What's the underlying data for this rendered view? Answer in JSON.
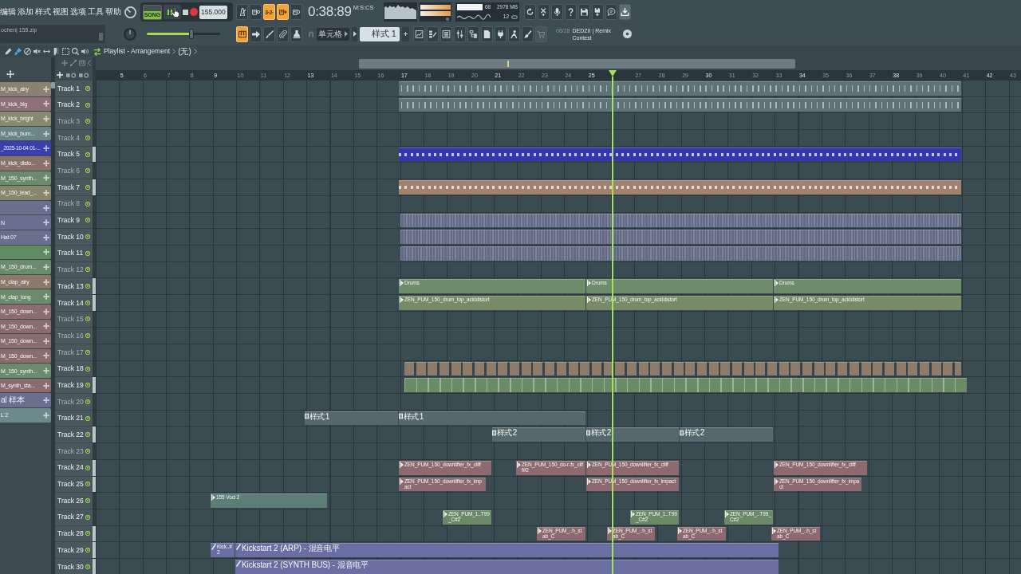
{
  "menu": [
    "编辑",
    "添加",
    "样式",
    "视图",
    "选项",
    "工具",
    "帮助"
  ],
  "hint_bar": "ochen| 155.zip",
  "transport": {
    "mode": "SONG",
    "song_mode": true,
    "playing": true,
    "tempo": "155.000"
  },
  "toggles": [
    {
      "kind": "metronome",
      "on": false
    },
    {
      "kind": "wait",
      "on": false
    },
    {
      "kind": "countdown",
      "label": "3·2·",
      "on": true
    },
    {
      "kind": "blend",
      "on": true
    },
    {
      "kind": "loop",
      "on": false
    }
  ],
  "time": {
    "value": "0:38:89",
    "format": "M:S:CS"
  },
  "monitor": {
    "cpu": "68",
    "memory": "2978 MB",
    "voices": "12"
  },
  "master_volume": {
    "level": 0.61
  },
  "tools": [
    {
      "kind": "typing",
      "on": true
    },
    {
      "kind": "step",
      "on": false
    },
    {
      "kind": "script",
      "on": false
    },
    {
      "kind": "link",
      "on": false
    },
    {
      "kind": "stamp",
      "on": false
    }
  ],
  "snap": "单元格",
  "pattern": "样式 1",
  "news": {
    "date": "08/28",
    "headline": "DEDZII | Remix Contest"
  },
  "playlist_bar": {
    "tools": [
      {
        "kind": "draw",
        "selected": false
      },
      {
        "kind": "paint",
        "selected": true
      },
      {
        "kind": "delete",
        "selected": false
      },
      {
        "kind": "mute",
        "selected": false
      },
      {
        "kind": "slip",
        "selected": false
      },
      {
        "kind": "slice",
        "selected": false
      },
      {
        "kind": "select",
        "selected": false
      },
      {
        "kind": "zoom",
        "selected": false
      },
      {
        "kind": "playback",
        "selected": false
      }
    ],
    "title": "Playlist - Arrangement",
    "arrangement": "(无)"
  },
  "clip_sources": [
    {
      "label": "M_kick_airy",
      "color": "#8b8170"
    },
    {
      "label": "M_kick_big",
      "color": "#8e6f7a"
    },
    {
      "label": "M_kick_bright",
      "color": "#878a6c"
    },
    {
      "label": "M_kick_bum...",
      "color": "#6b8784"
    },
    {
      "label": "_2025-10-04 01-...",
      "color": "#3b3fae"
    },
    {
      "label": "M_kick_disto...",
      "color": "#8b7268"
    },
    {
      "label": "M_150_synth...",
      "color": "#6c8a6e"
    },
    {
      "label": "M_150_lead_...",
      "color": "#8a866c"
    },
    {
      "color": "#6b6f8f"
    },
    {
      "label": "N",
      "color": "#6b6f8f"
    },
    {
      "label": "Hat 07",
      "color": "#6b6f8f"
    },
    {
      "color": "#5f8a62"
    },
    {
      "label": "M_150_drum...",
      "color": "#6c8a6e"
    },
    {
      "label": "M_clap_airy",
      "color": "#8b7a6c"
    },
    {
      "label": "M_clap_long",
      "color": "#6c8a6e"
    },
    {
      "label": "M_150_down...",
      "color": "#8b6d70"
    },
    {
      "label": "M_150_down...",
      "color": "#8b6d70"
    },
    {
      "label": "M_150_down...",
      "color": "#8b6d70"
    },
    {
      "label": "M_150_down...",
      "color": "#8b6d70"
    },
    {
      "label": "M_150_synth...",
      "color": "#6c8a6e"
    },
    {
      "label": "M_synth_sta...",
      "color": "#8b6d70"
    },
    {
      "label": "al 样本",
      "color": "#6b6f8f"
    },
    {
      "label": "L 2",
      "color": "#6c8a8a"
    }
  ],
  "ruler": [
    "5",
    "6",
    "7",
    "8",
    "9",
    "10",
    "11",
    "12",
    "13",
    "14",
    "15",
    "16",
    "17",
    "18",
    "19",
    "20",
    "21",
    "22",
    "23",
    "24",
    "25",
    "27",
    "28",
    "29",
    "30",
    "31",
    "32",
    "33",
    "34",
    "35",
    "36",
    "37",
    "38",
    "39",
    "40",
    "41",
    "42",
    "43"
  ],
  "tracks": [
    {
      "name": "Track 1",
      "dimmed": false,
      "enabled": true,
      "marked": false,
      "clips": [
        {
          "kind": "hits",
          "color": "#5f7376"
        }
      ]
    },
    {
      "name": "Track 2",
      "dimmed": false,
      "enabled": true,
      "marked": false,
      "clips": [
        {
          "kind": "hits",
          "color": "#5f7376"
        }
      ]
    },
    {
      "name": "Track 3",
      "dimmed": true,
      "enabled": true,
      "marked": false
    },
    {
      "name": "Track 4",
      "dimmed": true,
      "enabled": true,
      "marked": false
    },
    {
      "name": "Track 5",
      "dimmed": false,
      "enabled": true,
      "marked": true,
      "clips": [
        {
          "kind": "notes",
          "color": "#3535ad"
        }
      ]
    },
    {
      "name": "Track 6",
      "dimmed": true,
      "enabled": true,
      "marked": false
    },
    {
      "name": "Track 7",
      "dimmed": false,
      "enabled": true,
      "marked": true,
      "clips": [
        {
          "kind": "notes",
          "color": "#a0836f"
        }
      ]
    },
    {
      "name": "Track 8",
      "dimmed": true,
      "enabled": true,
      "marked": false
    },
    {
      "name": "Track 9",
      "dimmed": false,
      "enabled": true,
      "marked": false,
      "clips": [
        {
          "kind": "stripes",
          "color": "#646985"
        }
      ]
    },
    {
      "name": "Track 10",
      "dimmed": false,
      "enabled": true,
      "marked": false,
      "clips": [
        {
          "kind": "stripes",
          "color": "#646985"
        }
      ]
    },
    {
      "name": "Track 11",
      "dimmed": false,
      "enabled": true,
      "marked": false,
      "clips": [
        {
          "kind": "stripes",
          "color": "#646985"
        }
      ]
    },
    {
      "name": "Track 12",
      "dimmed": true,
      "enabled": true,
      "marked": false
    },
    {
      "name": "Track 13",
      "dimmed": false,
      "enabled": true,
      "marked": true,
      "clips": [
        {
          "kind": "audio",
          "label": "Drums",
          "color": "#6e8b6b"
        },
        {
          "kind": "audio",
          "label": "Drums",
          "color": "#6e8b6b"
        },
        {
          "kind": "audio",
          "label": "Drums",
          "color": "#6e8b6b"
        }
      ]
    },
    {
      "name": "Track 14",
      "dimmed": false,
      "enabled": true,
      "marked": true,
      "clips": [
        {
          "kind": "audio",
          "label": "ZEN_PUM_150_drum_top_aciddistort",
          "color": "#798a67"
        },
        {
          "kind": "audio",
          "label": "ZEN_PUM_150_drum_top_aciddistort",
          "color": "#798a67"
        },
        {
          "kind": "audio",
          "label": "ZEN_PUM_150_drum_top_aciddistort",
          "color": "#798a67"
        }
      ]
    },
    {
      "name": "Track 15",
      "dimmed": true,
      "enabled": true,
      "marked": false
    },
    {
      "name": "Track 16",
      "dimmed": true,
      "enabled": true,
      "marked": false
    },
    {
      "name": "Track 17",
      "dimmed": true,
      "enabled": true,
      "marked": false
    },
    {
      "name": "Track 18",
      "dimmed": false,
      "enabled": true,
      "marked": false,
      "clips": [
        {
          "kind": "slices",
          "color": "#8d7c69"
        }
      ]
    },
    {
      "name": "Track 19",
      "dimmed": false,
      "enabled": true,
      "marked": true,
      "clips": [
        {
          "kind": "markers",
          "color": "#6b8a66"
        }
      ]
    },
    {
      "name": "Track 20",
      "dimmed": true,
      "enabled": true,
      "marked": false
    },
    {
      "name": "Track 21",
      "dimmed": false,
      "enabled": true,
      "marked": false,
      "clips": [
        {
          "kind": "pattern",
          "label": "样式 1",
          "color": "#56686b"
        },
        {
          "kind": "pattern",
          "label": "样式 1",
          "color": "#56686b"
        }
      ]
    },
    {
      "name": "Track 22",
      "dimmed": false,
      "enabled": true,
      "marked": true,
      "clips": [
        {
          "kind": "pattern",
          "label": "样式 2",
          "color": "#56686b"
        },
        {
          "kind": "pattern",
          "label": "样式 2",
          "color": "#56686b"
        },
        {
          "kind": "pattern",
          "label": "样式 2",
          "color": "#56686b"
        }
      ]
    },
    {
      "name": "Track 23",
      "dimmed": true,
      "enabled": true,
      "marked": false
    },
    {
      "name": "Track 24",
      "dimmed": false,
      "enabled": true,
      "marked": true,
      "clips": [
        {
          "kind": "audio",
          "label": "ZEN_PUM_150_downlifter_fx_cliff",
          "color": "#8c6a70"
        },
        {
          "kind": "audio",
          "label": "ZEN_PUM_150_do-r-fx_cliff#2",
          "color": "#8c6a70"
        },
        {
          "kind": "audio",
          "label": "ZEN_PUM_150_downlifter_fx_cliff",
          "color": "#8c6a70"
        },
        {
          "kind": "audio",
          "label": "ZEN_PUM_150_downlifter_fx_cliff",
          "color": "#8c6a70"
        }
      ]
    },
    {
      "name": "Track 25",
      "dimmed": false,
      "enabled": true,
      "marked": true,
      "clips": [
        {
          "kind": "audio",
          "label": "ZEN_PUM_150_downlifter_fx_impact",
          "color": "#8c6a70"
        },
        {
          "kind": "audio",
          "label": "ZEN_PUM_150_downlifter_fx_impact",
          "color": "#8c6a70"
        },
        {
          "kind": "audio",
          "label": "ZEN_PUM_150_downlifter_fx_impact",
          "color": "#8c6a70"
        }
      ]
    },
    {
      "name": "Track 26",
      "dimmed": false,
      "enabled": true,
      "marked": false,
      "clips": [
        {
          "kind": "audio",
          "label": "155 Vocl 2",
          "color": "#5d7d77"
        }
      ]
    },
    {
      "name": "Track 27",
      "dimmed": false,
      "enabled": true,
      "marked": false,
      "clips": [
        {
          "kind": "audio",
          "label": "ZEN_PUM_1..T99_C#2",
          "color": "#6b8966"
        },
        {
          "kind": "audio",
          "label": "ZEN_PUM_1..T99_C#2",
          "color": "#6b8966"
        },
        {
          "kind": "audio",
          "label": "ZEN_PUM_..T99_C#2",
          "color": "#6b8966"
        }
      ]
    },
    {
      "name": "Track 28",
      "dimmed": false,
      "enabled": true,
      "marked": true,
      "clips": [
        {
          "kind": "audio",
          "label": "ZEN_PUM_..h_stab_C",
          "color": "#8c6a70"
        },
        {
          "kind": "audio",
          "label": "ZEN_PUM_..h_stab_C",
          "color": "#8c6a70"
        },
        {
          "kind": "audio",
          "label": "ZEN_PUM_..h_stab_C",
          "color": "#8c6a70"
        },
        {
          "kind": "audio",
          "label": "ZEN_PUM_..h_stab_C",
          "color": "#8c6a70"
        }
      ]
    },
    {
      "name": "Track 29",
      "dimmed": false,
      "enabled": true,
      "marked": true,
      "clips": [
        {
          "kind": "automation",
          "label": "Kick..#2",
          "color": "#6a6ea3"
        },
        {
          "kind": "automation",
          "label": "Kickstart 2 (ARP) - 混音电平",
          "color": "#6a6ea3"
        }
      ]
    },
    {
      "name": "Track 30",
      "dimmed": false,
      "enabled": true,
      "marked": true,
      "clips": [
        {
          "kind": "automation",
          "label": "Kickstart 2 (SYNTH BUS) - 混音电平",
          "color": "#6a6ea3"
        }
      ]
    }
  ]
}
